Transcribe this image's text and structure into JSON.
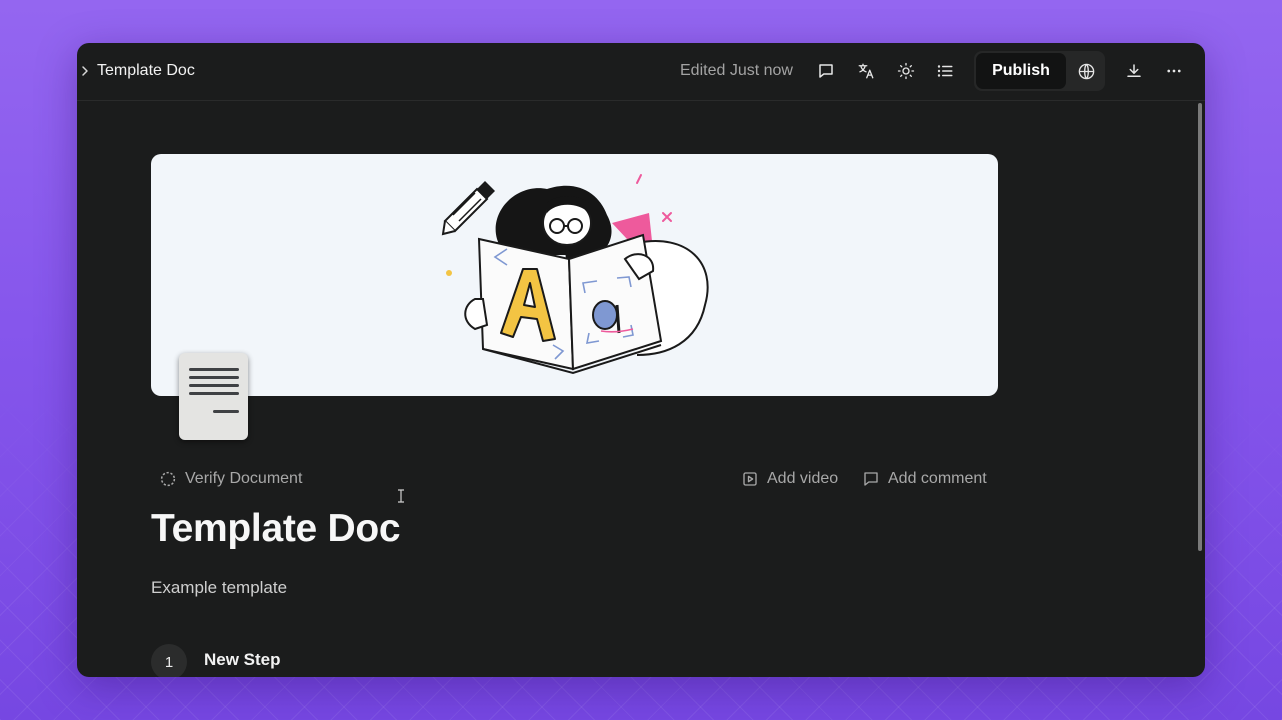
{
  "header": {
    "breadcrumb_title": "Template Doc",
    "status": "Edited Just now",
    "icons": [
      "comment-icon",
      "translate-icon",
      "sun-icon",
      "list-icon",
      "globe-icon",
      "download-icon",
      "more-icon"
    ],
    "publish_label": "Publish"
  },
  "document": {
    "verify_label": "Verify Document",
    "add_video_label": "Add video",
    "add_comment_label": "Add comment",
    "title": "Template Doc",
    "description": "Example template",
    "steps": [
      {
        "number": "1",
        "title": "New Step"
      }
    ]
  },
  "colors": {
    "background": "#8656ec",
    "window": "#1b1c1c",
    "cover": "#f2f6fa",
    "illustration_yellow": "#f3c443",
    "illustration_pink": "#ee5a9c",
    "illustration_blue": "#7f98d2"
  }
}
